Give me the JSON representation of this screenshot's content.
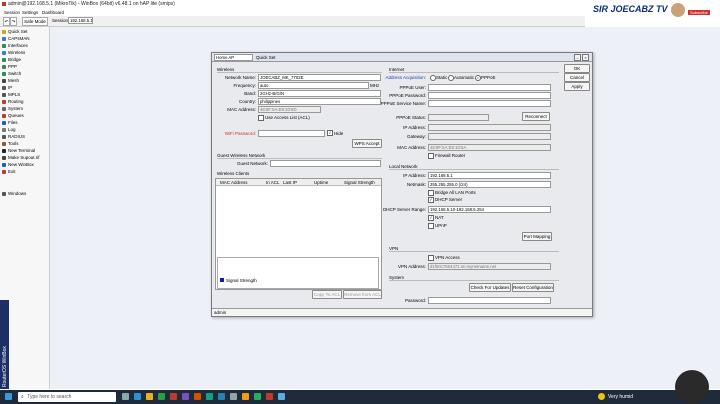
{
  "window_title": "admin@192.168.5.1 (MikroTik) - WinBox (64bit) v6.48.1 on hAP lite (smips)",
  "menu": [
    "Session",
    "Settings",
    "Dashboard"
  ],
  "toolbar": {
    "safe_mode": "Safe Mode",
    "session_label": "Session:",
    "session_value": "192.168.5.1"
  },
  "sidebar": {
    "items": [
      {
        "label": "Quick Set",
        "color": "#d9a400"
      },
      {
        "label": "CAPsMAN",
        "color": "#3a7bd5"
      },
      {
        "label": "Interfaces",
        "color": "#2e8b57"
      },
      {
        "label": "Wireless",
        "color": "#3a7bd5"
      },
      {
        "label": "Bridge",
        "color": "#2e8b57"
      },
      {
        "label": "PPP",
        "color": "#2e8b57"
      },
      {
        "label": "Switch",
        "color": "#2e8b57"
      },
      {
        "label": "Mesh",
        "color": "#444"
      },
      {
        "label": "IP",
        "color": "#555"
      },
      {
        "label": "MPLS",
        "color": "#555"
      },
      {
        "label": "Routing",
        "color": "#c0392b"
      },
      {
        "label": "System",
        "color": "#666"
      },
      {
        "label": "Queues",
        "color": "#c0392b"
      },
      {
        "label": "Files",
        "color": "#1f5fbf"
      },
      {
        "label": "Log",
        "color": "#777"
      },
      {
        "label": "RADIUS",
        "color": "#555"
      },
      {
        "label": "Tools",
        "color": "#a0522d"
      },
      {
        "label": "New Terminal",
        "color": "#222"
      },
      {
        "label": "Make Supout.rif",
        "color": "#444"
      },
      {
        "label": "New WinBox",
        "color": "#1f5fbf"
      },
      {
        "label": "Exit",
        "color": "#c0392b"
      },
      {
        "label": "Windows",
        "color": "#555"
      }
    ],
    "brand": "RouterOS WinBox"
  },
  "dialog": {
    "mode": "Home AP",
    "title": "Quick Set",
    "buttons": {
      "ok": "OK",
      "cancel": "Cancel",
      "apply": "Apply"
    },
    "wireless": {
      "section": "Wireless",
      "network_name_label": "Network Name:",
      "network_name": "JOECABZ_MK_7702E",
      "frequency_label": "Frequency:",
      "frequency": "auto",
      "frequency_unit": "MHz",
      "band_label": "Band:",
      "band": "2GHz-B/G/N",
      "country_label": "Country:",
      "country": "philippines",
      "mac_label": "MAC Address:",
      "mac": "48:8F:5A:E9:10:5D",
      "access_list_label": "Use Access List (ACL)",
      "wifi_password_label": "WiFi Password:",
      "hide_label": "Hide",
      "wps_button": "WPS Accept"
    },
    "guest": {
      "section": "Guest Wireless Network",
      "guest_network_label": "Guest Network:"
    },
    "clients": {
      "section": "Wireless Clients",
      "columns": [
        "MAC Address",
        "In ACL",
        "Last IP",
        "Uptime",
        "Signal Strength"
      ],
      "legend": "Signal Strength",
      "copy_button": "Copy To ACL",
      "remove_button": "Remove from ACL"
    },
    "internet": {
      "section": "Internet",
      "acq_label": "Address Acquisition:",
      "acq_options": [
        "Static",
        "Automatic",
        "PPPoE"
      ],
      "pppoe_user_label": "PPPoE User:",
      "pppoe_password_label": "PPPoE Password:",
      "pppoe_service_label": "PPPoE Service Name:",
      "pppoe_status_label": "PPPoE Status:",
      "reconnect_button": "Reconnect",
      "ip_label": "IP Address:",
      "gateway_label": "Gateway:",
      "mac_label": "MAC Address:",
      "mac": "48:8F:5A:E9:10:5A",
      "firewall_label": "Firewall Router"
    },
    "local": {
      "section": "Local Network",
      "ip_label": "IP Address:",
      "ip": "192.168.5.1",
      "netmask_label": "Netmask:",
      "netmask": "255.255.255.0 (/24)",
      "bridge_label": "Bridge All LAN Ports",
      "dhcp_server_label": "DHCP Server",
      "dhcp_range_label": "DHCP Server Range:",
      "dhcp_range": "192.168.5.10-192.168.5.254",
      "nat_label": "NAT",
      "upnp_label": "UPnP",
      "port_mapping_button": "Port Mapping"
    },
    "vpn": {
      "section": "VPN",
      "vpn_access_label": "VPN Access",
      "vpn_address_label": "VPN Address:",
      "vpn_address": "d1f60c7664471.sn.mynetname.net"
    },
    "system": {
      "section": "System",
      "check_updates_button": "Check For Updates",
      "reset_button": "Reset Configuration",
      "password_label": "Password:"
    },
    "status_text": "admin"
  },
  "logo": {
    "text": "SIR JOECABZ TV",
    "subscribe": "Subscribe"
  },
  "taskbar": {
    "search_placeholder": "Type here to search",
    "weather": "Very humid"
  }
}
